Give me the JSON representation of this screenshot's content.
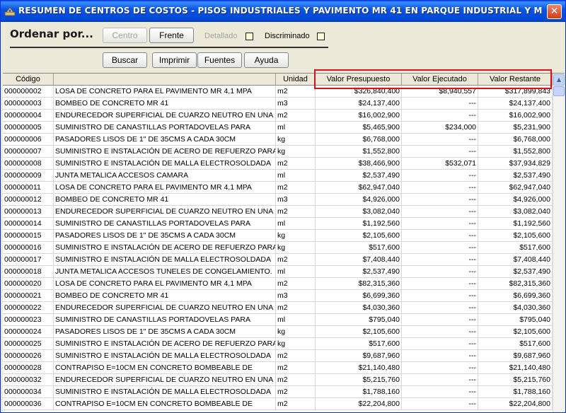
{
  "window": {
    "title": "RESUMEN DE CENTROS DE COSTOS - PISOS INDUSTRIALES Y PAVIMENTO MR 41 EN PARQUE INDUSTRIAL Y METROPOLITA...",
    "close_label": "✕"
  },
  "toolbar": {
    "ordenar_label": "Ordenar por...",
    "centro_label": "Centro",
    "frente_label": "Frente",
    "detallado_label": "Detallado",
    "discriminado_label": "Discriminado",
    "buscar_label": "Buscar",
    "imprimir_label": "Imprimir",
    "fuentes_label": "Fuentes",
    "ayuda_label": "Ayuda"
  },
  "table": {
    "headers": {
      "codigo": "Código",
      "descripcion": "",
      "unidad": "Unidad",
      "presupuesto": "Valor Presupuesto",
      "ejecutado": "Valor Ejecutado",
      "restante": "Valor Restante"
    },
    "rows": [
      {
        "code": "000000002",
        "desc": "LOSA DE CONCRETO PARA EL PAVIMENTO  MR 4,1 MPA",
        "unit": "m2",
        "pres": "$326,840,400",
        "ejec": "$8,940,557",
        "rest": "$317,899,843"
      },
      {
        "code": "000000003",
        "desc": "BOMBEO DE CONCRETO MR 41",
        "unit": "m3",
        "pres": "$24,137,400",
        "ejec": "---",
        "rest": "$24,137,400"
      },
      {
        "code": "000000004",
        "desc": "ENDURECEDOR SUPERFICIAL DE CUARZO NEUTRO EN UNA",
        "unit": "m2",
        "pres": "$16,002,900",
        "ejec": "---",
        "rest": "$16,002,900"
      },
      {
        "code": "000000005",
        "desc": "SUMINISTRO DE CANASTILLAS PORTADOVELAS PARA",
        "unit": "ml",
        "pres": "$5,465,900",
        "ejec": "$234,000",
        "rest": "$5,231,900"
      },
      {
        "code": "000000006",
        "desc": "PASADORES LISOS DE 1\" DE 35CMS A CADA 30CM",
        "unit": "kg",
        "pres": "$6,768,000",
        "ejec": "---",
        "rest": "$6,768,000"
      },
      {
        "code": "000000007",
        "desc": "SUMINISTRO E INSTALACIÓN DE ACERO DE REFUERZO PARA",
        "unit": "kg",
        "pres": "$1,552,800",
        "ejec": "---",
        "rest": "$1,552,800"
      },
      {
        "code": "000000008",
        "desc": "SUMINISTRO E INSTALACIÓN DE MALLA ELECTROSOLDADA",
        "unit": "m2",
        "pres": "$38,466,900",
        "ejec": "$532,071",
        "rest": "$37,934,829"
      },
      {
        "code": "000000009",
        "desc": "JUNTA METALICA ACCESOS CAMARA",
        "unit": "ml",
        "pres": "$2,537,490",
        "ejec": "---",
        "rest": "$2,537,490"
      },
      {
        "code": "000000011",
        "desc": "LOSA DE CONCRETO PARA EL PAVIMENTO  MR 4,1 MPA",
        "unit": "m2",
        "pres": "$62,947,040",
        "ejec": "---",
        "rest": "$62,947,040"
      },
      {
        "code": "000000012",
        "desc": "BOMBEO DE CONCRETO MR 41",
        "unit": "m3",
        "pres": "$4,926,000",
        "ejec": "---",
        "rest": "$4,926,000"
      },
      {
        "code": "000000013",
        "desc": "ENDURECEDOR SUPERFICIAL DE CUARZO NEUTRO EN UNA",
        "unit": "m2",
        "pres": "$3,082,040",
        "ejec": "---",
        "rest": "$3,082,040"
      },
      {
        "code": "000000014",
        "desc": "SUMINISTRO DE CANASTILLAS PORTADOVELAS PARA",
        "unit": "ml",
        "pres": "$1,192,560",
        "ejec": "---",
        "rest": "$1,192,560"
      },
      {
        "code": "000000015",
        "desc": "PASADORES LISOS DE 1\" DE 35CMS A CADA 30CM",
        "unit": "kg",
        "pres": "$2,105,600",
        "ejec": "---",
        "rest": "$2,105,600"
      },
      {
        "code": "000000016",
        "desc": "SUMINISTRO E INSTALACIÓN DE ACERO DE REFUERZO PARA",
        "unit": "kg",
        "pres": "$517,600",
        "ejec": "---",
        "rest": "$517,600"
      },
      {
        "code": "000000017",
        "desc": "SUMINISTRO E INSTALACIÓN DE MALLA ELECTROSOLDADA",
        "unit": "m2",
        "pres": "$7,408,440",
        "ejec": "---",
        "rest": "$7,408,440"
      },
      {
        "code": "000000018",
        "desc": "JUNTA METALICA ACCESOS TUNELES DE CONGELAMIENTO.",
        "unit": "ml",
        "pres": "$2,537,490",
        "ejec": "---",
        "rest": "$2,537,490"
      },
      {
        "code": "000000020",
        "desc": "LOSA DE CONCRETO PARA EL PAVIMENTO  MR 4,1 MPA",
        "unit": "m2",
        "pres": "$82,315,360",
        "ejec": "---",
        "rest": "$82,315,360"
      },
      {
        "code": "000000021",
        "desc": "BOMBEO DE CONCRETO MR 41",
        "unit": "m3",
        "pres": "$6,699,360",
        "ejec": "---",
        "rest": "$6,699,360"
      },
      {
        "code": "000000022",
        "desc": "ENDURECEDOR SUPERFICIAL DE CUARZO NEUTRO EN UNA",
        "unit": "m2",
        "pres": "$4,030,360",
        "ejec": "---",
        "rest": "$4,030,360"
      },
      {
        "code": "000000023",
        "desc": "SUMINISTRO DE CANASTILLAS PORTADOVELAS PARA",
        "unit": "ml",
        "pres": "$795,040",
        "ejec": "---",
        "rest": "$795,040"
      },
      {
        "code": "000000024",
        "desc": "PASADORES LISOS DE 1\" DE 35CMS A CADA 30CM",
        "unit": "kg",
        "pres": "$2,105,600",
        "ejec": "---",
        "rest": "$2,105,600"
      },
      {
        "code": "000000025",
        "desc": "SUMINISTRO E INSTALACIÓN DE ACERO DE REFUERZO PARA",
        "unit": "kg",
        "pres": "$517,600",
        "ejec": "---",
        "rest": "$517,600"
      },
      {
        "code": "000000026",
        "desc": "SUMINISTRO E INSTALACIÓN DE MALLA ELECTROSOLDADA",
        "unit": "m2",
        "pres": "$9,687,960",
        "ejec": "---",
        "rest": "$9,687,960"
      },
      {
        "code": "000000028",
        "desc": "CONTRAPISO E=10CM EN CONCRETO BOMBEABLE DE",
        "unit": "m2",
        "pres": "$21,140,480",
        "ejec": "---",
        "rest": "$21,140,480"
      },
      {
        "code": "000000032",
        "desc": "ENDURECEDOR SUPERFICIAL DE CUARZO NEUTRO EN UNA",
        "unit": "m2",
        "pres": "$5,215,760",
        "ejec": "---",
        "rest": "$5,215,760"
      },
      {
        "code": "000000034",
        "desc": "SUMINISTRO E INSTALACIÓN DE MALLA ELECTROSOLDADA",
        "unit": "m2",
        "pres": "$1,788,160",
        "ejec": "---",
        "rest": "$1,788,160"
      },
      {
        "code": "000000036",
        "desc": "CONTRAPISO E=10CM EN CONCRETO BOMBEABLE DE",
        "unit": "m2",
        "pres": "$22,204,800",
        "ejec": "---",
        "rest": "$22,204,800"
      }
    ]
  },
  "scrollbar": {
    "up_glyph": "▲",
    "down_glyph": "▼"
  }
}
